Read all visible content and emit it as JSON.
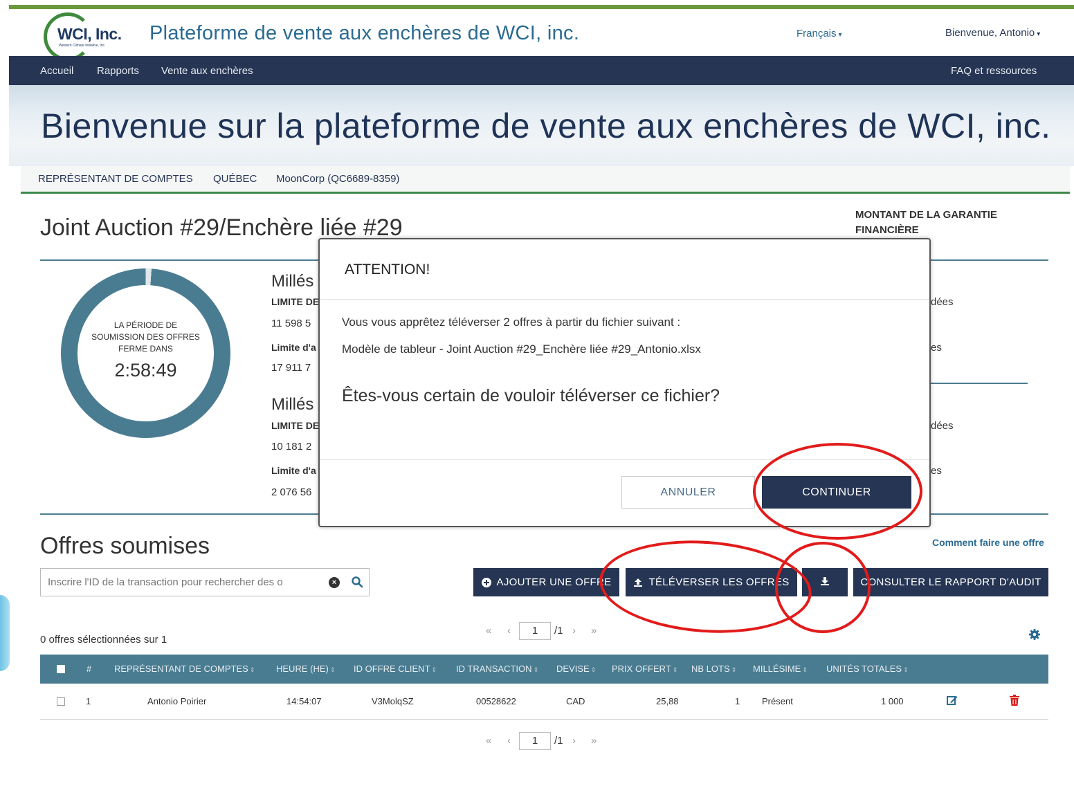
{
  "header": {
    "logo_text": "WCI, Inc.",
    "logo_sub": "Western Climate Initiative, Inc.",
    "site_title": "Plateforme de vente aux enchères de WCI, inc.",
    "language": "Français",
    "welcome": "Bienvenue, Antonio"
  },
  "nav": {
    "items": [
      "Accueil",
      "Rapports",
      "Vente aux enchères"
    ],
    "right": "FAQ et ressources"
  },
  "hero": {
    "title": "Bienvenue sur la plateforme de vente aux enchères de WCI, inc."
  },
  "infobar": {
    "role": "REPRÉSENTANT DE COMPTES",
    "jurisdiction": "QUÉBEC",
    "entity": "MoonCorp (QC6689-8359)"
  },
  "auction": {
    "title": "Joint Auction #29/Enchère liée #29",
    "guarantee_label": "MONTANT DE LA GARANTIE FINANCIÈRE",
    "timer_label_lines": [
      "LA PÉRIODE DE",
      "SOUMISSION DES OFFRES",
      "FERME DANS"
    ],
    "timer": "2:58:49",
    "timer_progress": 0.99,
    "partials": {
      "vintage1": "Millés",
      "limit1": "LIMITE DE",
      "val1": "11 598 5",
      "limit1b": "Limite d'a",
      "val1b": "17 911 7",
      "vintage2": "Millés",
      "limit2": "LIMITE DE",
      "val2": "10 181 2",
      "limit2b": "Limite d'a",
      "val2b": "2 076 56",
      "right1": "dées",
      "right2": "es",
      "right3": "dées",
      "right4": "es"
    }
  },
  "offers": {
    "title": "Offres soumises",
    "howto": "Comment faire une offre",
    "search_placeholder": "Inscrire l'ID de la transaction pour rechercher des o",
    "btn_add": "AJOUTER UNE OFFRE",
    "btn_upload": "TÉLÉVERSER LES OFFRES",
    "btn_audit": "CONSULTER LE RAPPORT D'AUDIT",
    "selected": "0 offres sélectionnées sur 1",
    "pager": {
      "first": "«",
      "prev": "‹",
      "page": "1",
      "total": "/1",
      "next": "›",
      "last": "»"
    },
    "columns": [
      "#",
      "REPRÉSENTANT DE COMPTES",
      "HEURE (HE)",
      "ID OFFRE CLIENT",
      "ID TRANSACTION",
      "DEVISE",
      "PRIX OFFERT",
      "NB LOTS",
      "MILLÉSIME",
      "UNITÉS TOTALES"
    ],
    "rows": [
      {
        "num": "1",
        "rep": "Antonio Poirier",
        "time": "14:54:07",
        "client_id": "V3MolqSZ",
        "tx_id": "00528622",
        "currency": "CAD",
        "price": "25,88",
        "lots": "1",
        "vintage": "Présent",
        "units": "1 000"
      }
    ]
  },
  "modal": {
    "title": "ATTENTION!",
    "line1": "Vous vous apprêtez téléverser 2 offres à partir du fichier suivant :",
    "line2": "Modèle de tableur - Joint Auction #29_Enchère liée #29_Antonio.xlsx",
    "question": "Êtes-vous certain de vouloir téléverser ce fichier?",
    "cancel": "ANNULER",
    "continue": "CONTINUER"
  },
  "colors": {
    "navy": "#253553",
    "teal": "#4a7c91",
    "green": "#3b8a4b",
    "annotation_red": "#e21b1b"
  }
}
